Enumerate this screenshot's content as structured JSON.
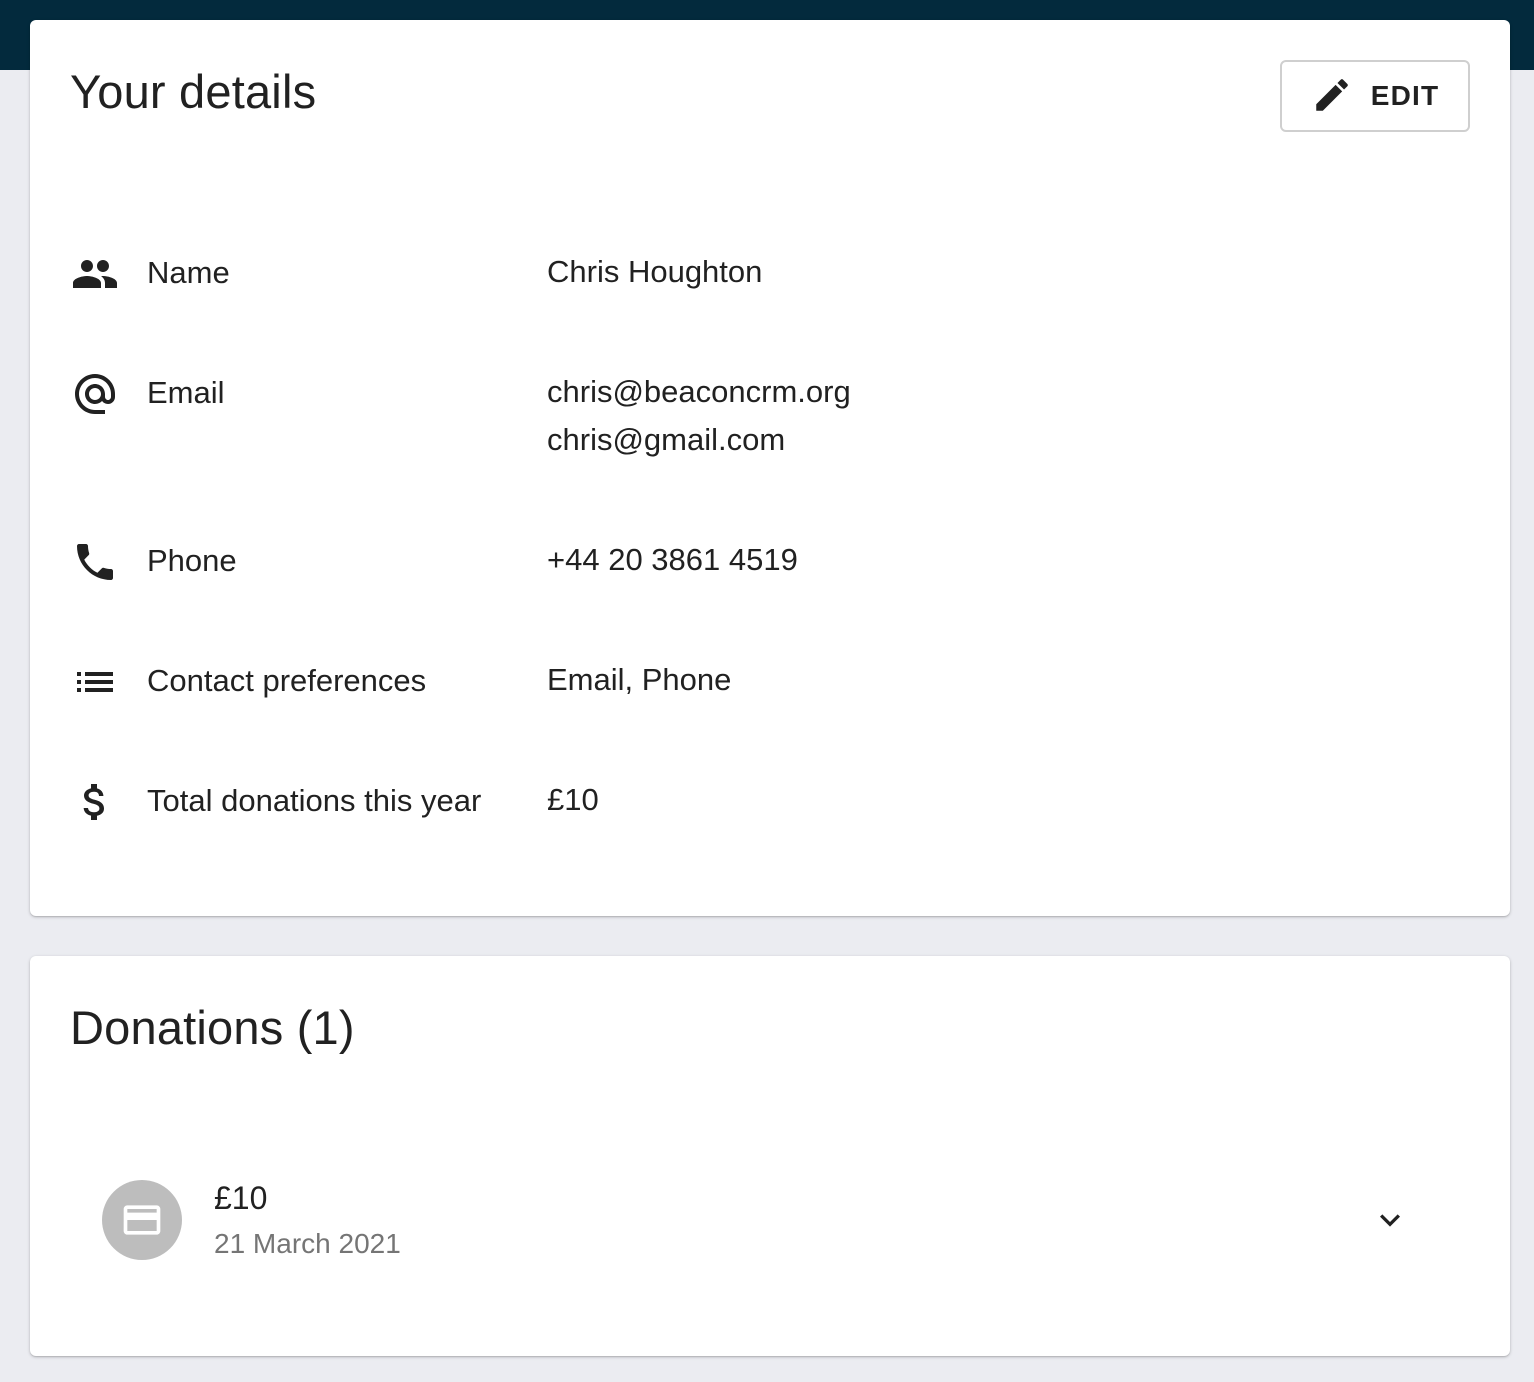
{
  "details": {
    "title": "Your details",
    "edit_label": "EDIT",
    "rows": [
      {
        "icon": "people-icon",
        "label": "Name",
        "values": [
          "Chris Houghton"
        ]
      },
      {
        "icon": "at-sign-icon",
        "label": "Email",
        "values": [
          "chris@beaconcrm.org",
          "chris@gmail.com"
        ]
      },
      {
        "icon": "phone-icon",
        "label": "Phone",
        "values": [
          "+44 20 3861 4519"
        ]
      },
      {
        "icon": "list-icon",
        "label": "Contact preferences",
        "values": [
          "Email, Phone"
        ]
      },
      {
        "icon": "dollar-icon",
        "label": "Total donations this year",
        "values": [
          "£10"
        ]
      }
    ]
  },
  "donations": {
    "title": "Donations (1)",
    "items": [
      {
        "icon": "credit-card-icon",
        "amount": "£10",
        "date": "21 March 2021"
      }
    ]
  },
  "colors": {
    "top_bar": "#032a3d",
    "page_background": "#ebecf1",
    "card_background": "#ffffff",
    "text_primary": "#212121",
    "text_secondary": "#757575",
    "avatar_background": "#bdbdbd"
  }
}
